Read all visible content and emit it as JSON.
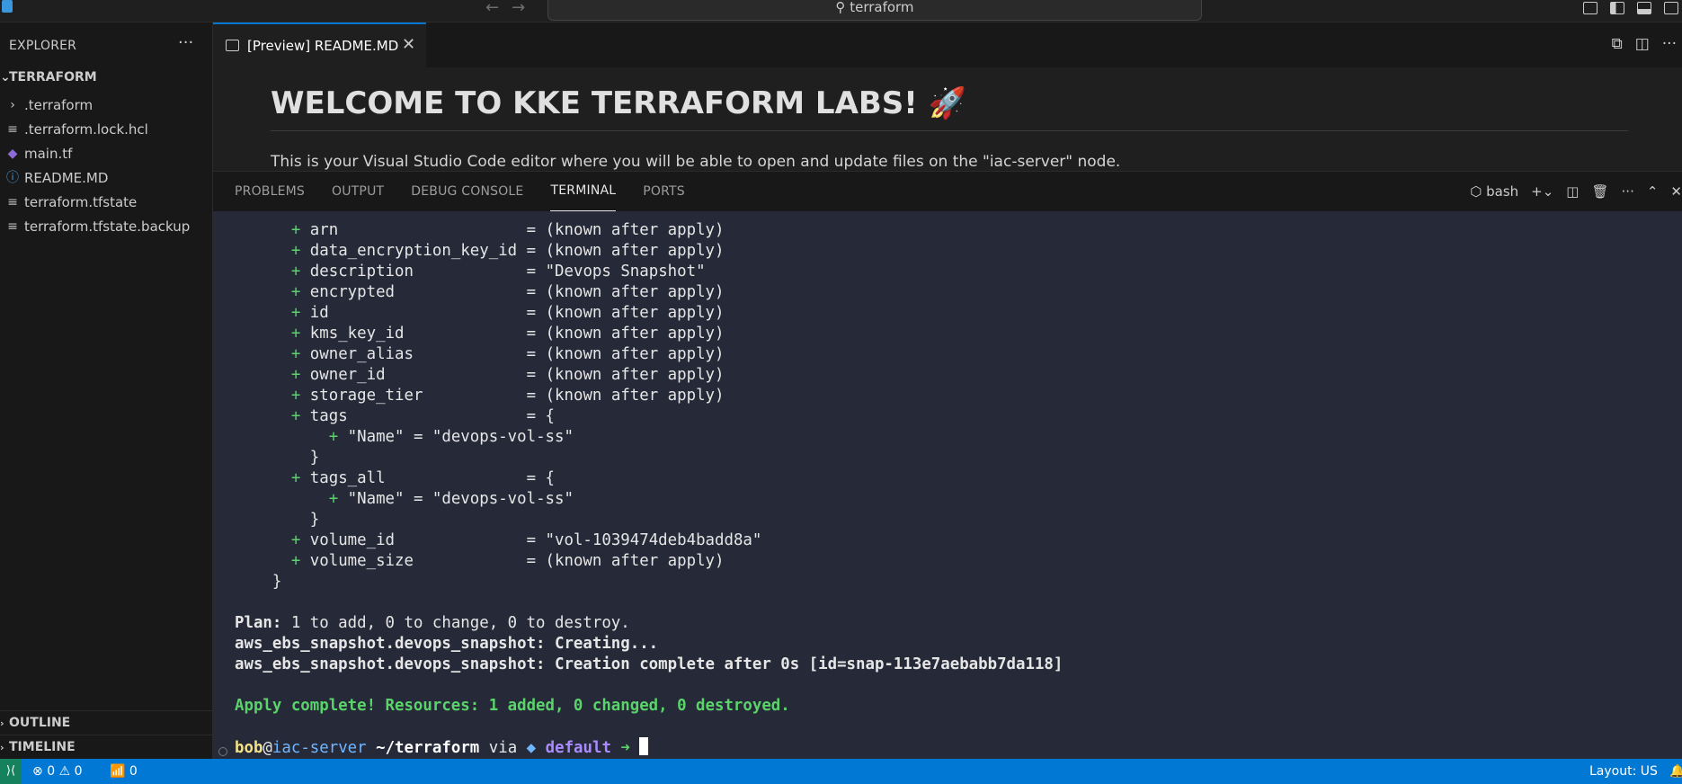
{
  "window": {
    "search_text": "terraform",
    "back_icon": "arrow-left-icon",
    "forward_icon": "arrow-right-icon"
  },
  "explorer": {
    "header": "EXPLORER",
    "root": "TERRAFORM",
    "files": [
      {
        "label": ".terraform",
        "icon": "chevron-right-icon"
      },
      {
        "label": ".terraform.lock.hcl",
        "icon": "lines-icon"
      },
      {
        "label": "main.tf",
        "icon": "terraform-icon"
      },
      {
        "label": "README.MD",
        "icon": "info-icon"
      },
      {
        "label": "terraform.tfstate",
        "icon": "lines-icon"
      },
      {
        "label": "terraform.tfstate.backup",
        "icon": "lines-icon"
      }
    ],
    "outline": "OUTLINE",
    "timeline": "TIMELINE"
  },
  "editor": {
    "tab_label": "[Preview] README.MD",
    "heading": "WELCOME TO KKE TERRAFORM LABS! 🚀",
    "paragraph": "This is your Visual Studio Code editor where you will be able to open and update files on the \"iac-server\" node."
  },
  "panel": {
    "tabs": [
      "PROBLEMS",
      "OUTPUT",
      "DEBUG CONSOLE",
      "TERMINAL",
      "PORTS"
    ],
    "active_tab": "TERMINAL",
    "shell": "bash"
  },
  "terminal": {
    "attrs": [
      {
        "name": "arn",
        "value": "(known after apply)"
      },
      {
        "name": "data_encryption_key_id",
        "value": "(known after apply)"
      },
      {
        "name": "description",
        "value": "\"Devops Snapshot\""
      },
      {
        "name": "encrypted",
        "value": "(known after apply)"
      },
      {
        "name": "id",
        "value": "(known after apply)"
      },
      {
        "name": "kms_key_id",
        "value": "(known after apply)"
      },
      {
        "name": "owner_alias",
        "value": "(known after apply)"
      },
      {
        "name": "owner_id",
        "value": "(known after apply)"
      },
      {
        "name": "storage_tier",
        "value": "(known after apply)"
      }
    ],
    "tags_name": "tags",
    "tags_all_name": "tags_all",
    "tag_entry": "\"Name\" = \"devops-vol-ss\"",
    "volume_id": "\"vol-1039474deb4badd8a\"",
    "volume_size": "(known after apply)",
    "plan_label": "Plan:",
    "plan_text": " 1 to add, 0 to change, 0 to destroy.",
    "creating": "aws_ebs_snapshot.devops_snapshot: Creating...",
    "created": "aws_ebs_snapshot.devops_snapshot: Creation complete after 0s [id=snap-113e7aebabb7da118]",
    "apply": "Apply complete! Resources: 1 added, 0 changed, 0 destroyed.",
    "prompt": {
      "user": "bob",
      "at": "@",
      "host": "iac-server",
      "dir": "~/terraform",
      "via": "via",
      "diamond": "◆",
      "env": "default",
      "arrow": "➜"
    }
  },
  "status": {
    "errors": "0",
    "warnings": "0",
    "ports": "0",
    "layout": "Layout: US"
  },
  "colors": {
    "accent": "#0078d4",
    "terminal_bg": "#262a38",
    "plus": "#5ad36a"
  }
}
